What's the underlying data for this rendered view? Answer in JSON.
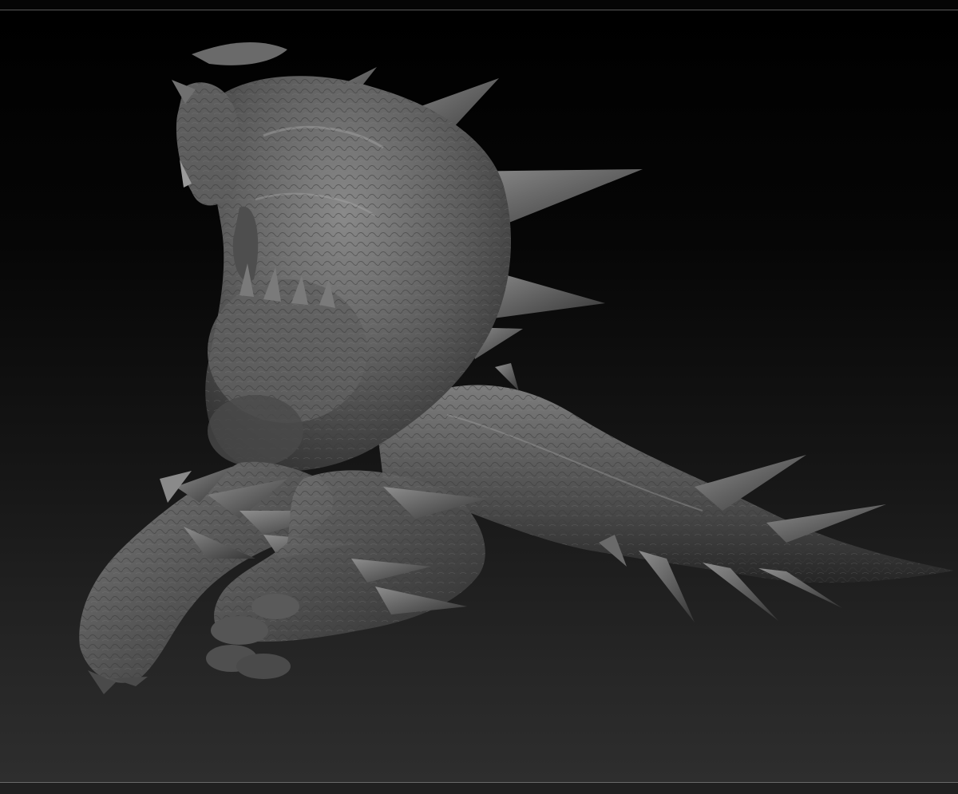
{
  "viewport": {
    "subject": "sculpt-model",
    "background_top": "#000000",
    "background_bottom": "#2e2e2e",
    "material_color": "#5c5c5c"
  },
  "icons": {
    "model": "creature-sculpt"
  }
}
